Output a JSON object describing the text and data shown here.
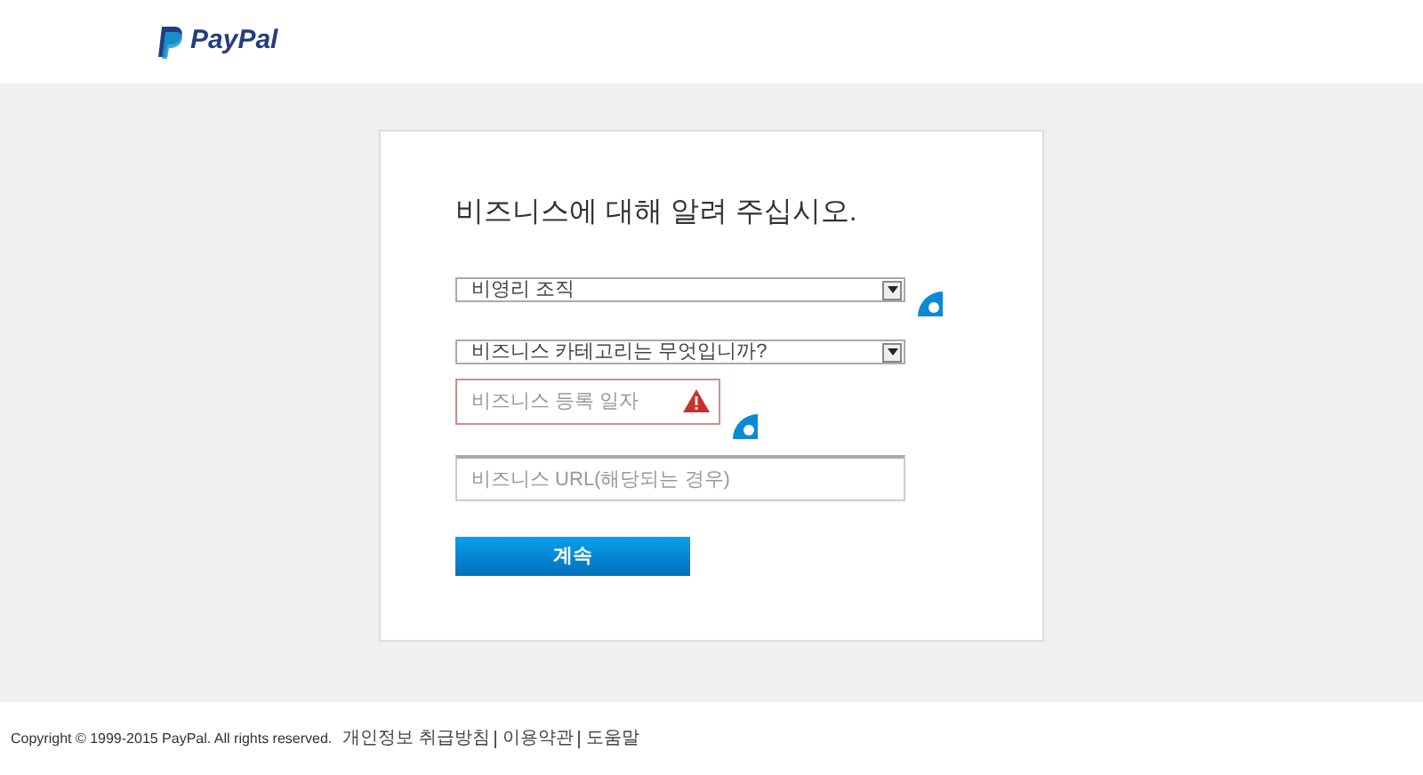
{
  "header": {
    "logo": "PayPal"
  },
  "form": {
    "title": "비즈니스에 대해 알려 주십시오.",
    "fields": [
      {
        "kind": "select",
        "value": "비영리 조직",
        "side_icon": true
      },
      {
        "kind": "select",
        "value": "비즈니스 카테고리는 무엇입니까?",
        "side_icon": false
      },
      {
        "kind": "input",
        "placeholder": "비즈니스 등록 일자",
        "error": true,
        "side_icon": true
      },
      {
        "kind": "input",
        "placeholder": "비즈니스 URL(해당되는 경우)",
        "error": false,
        "side_icon": false
      }
    ],
    "button": "계속"
  },
  "footer": {
    "copyright": "Copyright © 1999-2015 PayPal. All rights reserved.",
    "links": [
      "개인정보 취급방침",
      "이용약관",
      "도움말"
    ]
  }
}
